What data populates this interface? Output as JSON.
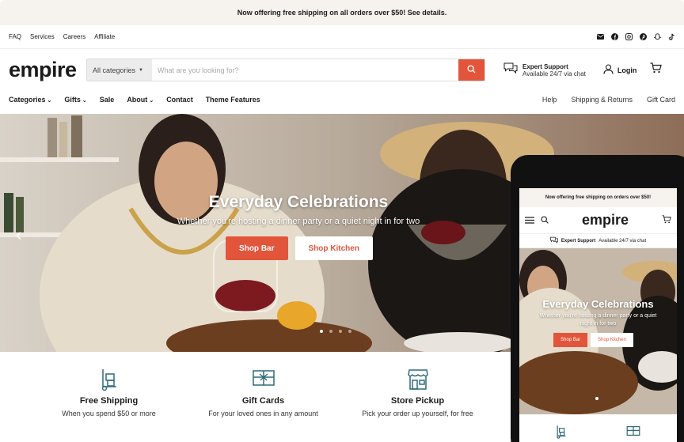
{
  "announcement": "Now offering free shipping on all orders over $50! See details.",
  "utility_links": [
    "FAQ",
    "Services",
    "Careers",
    "Affiliate"
  ],
  "social_icons": [
    "mail-icon",
    "facebook-icon",
    "instagram-icon",
    "pinterest-icon",
    "snapchat-icon",
    "tiktok-icon"
  ],
  "logo": "empire",
  "search": {
    "category": "All categories",
    "placeholder": "What are you looking for?"
  },
  "support": {
    "title": "Expert Support",
    "subtitle": "Available 24/7 via chat"
  },
  "login_label": "Login",
  "nav_left": [
    "Categories",
    "Gifts",
    "Sale",
    "About",
    "Contact",
    "Theme Features"
  ],
  "nav_right": [
    "Help",
    "Shipping & Returns",
    "Gift Card"
  ],
  "hero": {
    "title": "Everyday Celebrations",
    "subtitle": "Whether you're hosting a dinner party or a quiet night in for two",
    "button_primary": "Shop Bar",
    "button_secondary": "Shop Kitchen"
  },
  "features": [
    {
      "title": "Free Shipping",
      "desc": "When you spend $50 or more"
    },
    {
      "title": "Gift Cards",
      "desc": "For your loved ones in any amount"
    },
    {
      "title": "Store Pickup",
      "desc": "Pick your order up yourself, for free"
    }
  ],
  "mobile": {
    "announcement": "Now offering free shipping on orders over $50!",
    "logo": "empire",
    "support_title": "Expert Support",
    "support_subtitle": "Available 24/7 via chat",
    "hero_title": "Everyday Celebrations",
    "hero_subtitle": "Whether you're hosting a dinner party or a quiet night in for two",
    "button_primary": "Shop Bar",
    "button_secondary": "Shop Kitchen"
  },
  "colors": {
    "accent": "#e3553b",
    "announcement_bg": "#f6f3ee",
    "text": "#1b1b1b"
  }
}
